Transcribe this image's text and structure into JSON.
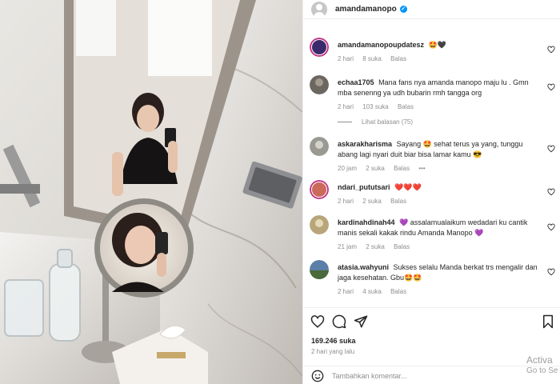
{
  "post": {
    "username": "amandamanopo",
    "verified_label": "✓"
  },
  "photo": {
    "alt": "mirror selfie in marble bathroom"
  },
  "comments": [
    {
      "user": "amandamanopoupdatesz",
      "text": "🤩🖤",
      "time": "2 hari",
      "likes": "8 suka",
      "reply": "Balas",
      "avatar_color": "#3b2a6b"
    },
    {
      "user": "echaa1705",
      "text": "Mana fans nya amanda manopo maju lu . Gmn mba senenng ya udh bubarin rmh tangga org",
      "time": "2 hari",
      "likes": "103 suka",
      "reply": "Balas",
      "avatar_color": "#6b6760"
    },
    {
      "user": "askarakharisma",
      "text": "Sayang 🤩 sehat terus ya yang, tunggu abang lagi nyari duit biar bisa lamar kamu 😎",
      "time": "20 jam",
      "likes": "2 suka",
      "reply": "Balas",
      "more": "•••",
      "avatar_color": "#9a9a94"
    },
    {
      "user": "ndari_pututsari",
      "text": "❤️❤️❤️",
      "time": "2 hari",
      "likes": "2 suka",
      "reply": "Balas",
      "avatar_color": "#c96a5a"
    },
    {
      "user": "kardinahdinah44",
      "text": "💜 assalamualaikum wedadari ku cantik manis sekali kakak rindu Amanda Manopo 💜",
      "time": "21 jam",
      "likes": "2 suka",
      "reply": "Balas",
      "avatar_color": "#b8a67a"
    },
    {
      "user": "atasia.wahyuni",
      "text": "Sukses selalu Manda berkat trs mengalir dan jaga kesehatan. Gbu🤩🤩",
      "time": "2 hari",
      "likes": "4 suka",
      "reply": "Balas",
      "avatar_color": "#5b7fa8"
    }
  ],
  "view_replies": "Lihat balasan (75)",
  "likes_count": "169.246 suka",
  "post_time": "2 hari yang lalu",
  "comment_input": {
    "placeholder": "Tambahkan komentar..."
  },
  "watermark": {
    "line1": "Activa",
    "line2": "Go to Se"
  },
  "icons": {
    "heart": "heart-icon",
    "comment": "comment-icon",
    "share": "share-icon",
    "bookmark": "bookmark-icon",
    "emoji": "emoji-icon"
  },
  "colors": {
    "verified": "#0095f6",
    "muted": "#8e8e8e",
    "heart_red": "#ed4956"
  }
}
